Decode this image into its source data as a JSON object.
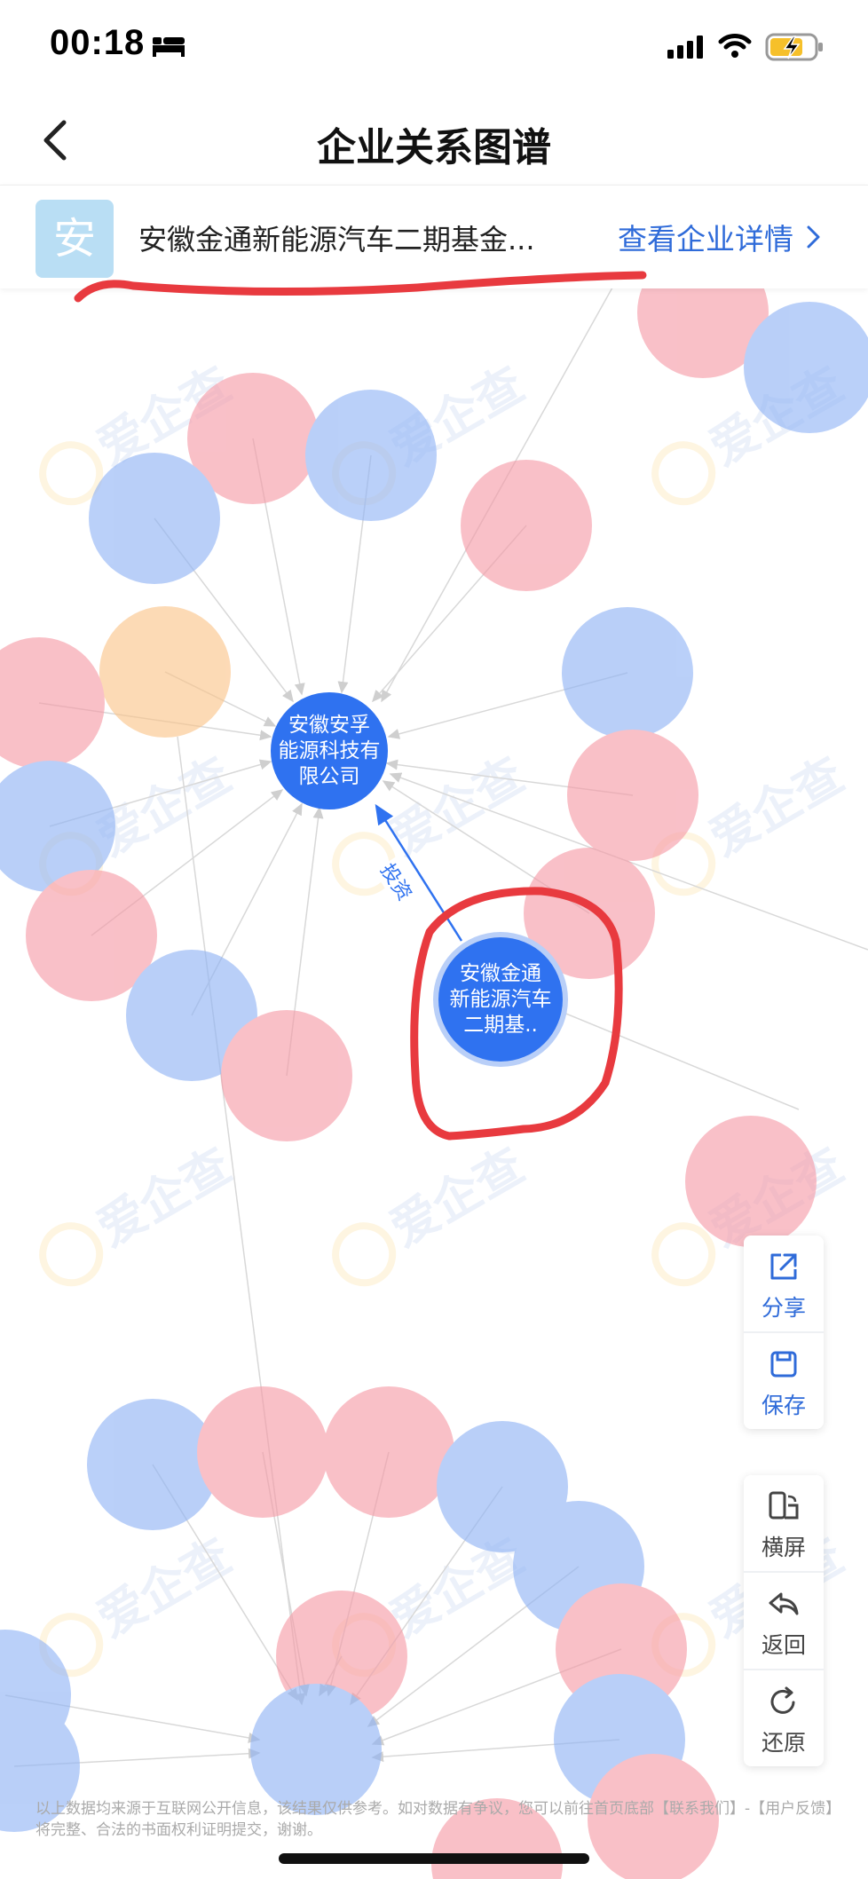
{
  "status_bar": {
    "time": "00:18"
  },
  "nav": {
    "title": "企业关系图谱"
  },
  "company": {
    "logo_char": "安",
    "name": "安徽金通新能源汽车二期基金...",
    "detail_link": "查看企业详情"
  },
  "graph": {
    "center_node": {
      "label_lines": [
        "安徽安孚",
        "能源科技有",
        "限公司"
      ],
      "color": "#2f72f0"
    },
    "focus_node": {
      "label_lines": [
        "安徽金通",
        "新能源汽车",
        "二期基.."
      ],
      "color": "#2f72f0"
    },
    "edge_label": "投资",
    "node_colors": {
      "blue": "#a9c5f7",
      "pink": "#f6a9b4",
      "orange": "#fbd3a4"
    },
    "watermark_text": "爱企查"
  },
  "toolbar": {
    "share": "分享",
    "save": "保存",
    "landscape": "横屏",
    "back": "返回",
    "restore": "还原"
  },
  "disclaimer": "以上数据均来源于互联网公开信息，该结果仅供参考。如对数据有争议，您可以前往首页底部【联系我们】-【用户反馈】将完整、合法的书面权利证明提交，谢谢。",
  "annotation_color": "#e83a3f"
}
